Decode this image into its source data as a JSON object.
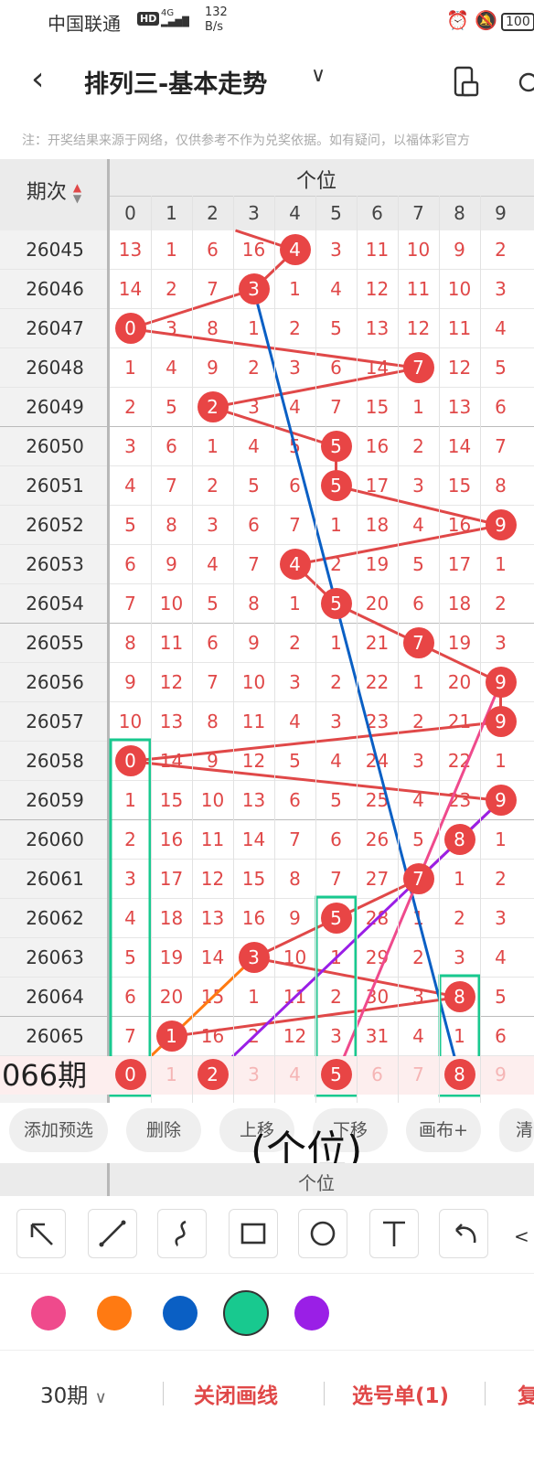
{
  "status_bar": {
    "carrier": "中国联通",
    "hd": "HD",
    "signal": "4G",
    "net_speed": "132",
    "net_unit": "B/s",
    "battery": "100"
  },
  "header": {
    "title": "排列三-基本走势"
  },
  "notice": "注：开奖结果来源于网络，仅供参考不作为兑奖依据。如有疑问，以福体彩官方",
  "table": {
    "period_header": "期次",
    "group_header": "个位",
    "digits": [
      "0",
      "1",
      "2",
      "3",
      "4",
      "5",
      "6",
      "7",
      "8",
      "9"
    ],
    "rows": [
      {
        "period": "26045",
        "cells": [
          "13",
          "1",
          "6",
          "16",
          "4",
          "3",
          "11",
          "10",
          "9",
          "2"
        ],
        "hit": 4
      },
      {
        "period": "26046",
        "cells": [
          "14",
          "2",
          "7",
          "3",
          "1",
          "4",
          "12",
          "11",
          "10",
          "3"
        ],
        "hit": 3
      },
      {
        "period": "26047",
        "cells": [
          "0",
          "3",
          "8",
          "1",
          "2",
          "5",
          "13",
          "12",
          "11",
          "4"
        ],
        "hit": 0
      },
      {
        "period": "26048",
        "cells": [
          "1",
          "4",
          "9",
          "2",
          "3",
          "6",
          "14",
          "7",
          "12",
          "5"
        ],
        "hit": 7
      },
      {
        "period": "26049",
        "cells": [
          "2",
          "5",
          "2",
          "3",
          "4",
          "7",
          "15",
          "1",
          "13",
          "6"
        ],
        "hit": 2
      },
      {
        "period": "26050",
        "cells": [
          "3",
          "6",
          "1",
          "4",
          "5",
          "5",
          "16",
          "2",
          "14",
          "7"
        ],
        "hit": 5
      },
      {
        "period": "26051",
        "cells": [
          "4",
          "7",
          "2",
          "5",
          "6",
          "5",
          "17",
          "3",
          "15",
          "8"
        ],
        "hit": 5
      },
      {
        "period": "26052",
        "cells": [
          "5",
          "8",
          "3",
          "6",
          "7",
          "1",
          "18",
          "4",
          "16",
          "9"
        ],
        "hit": 9
      },
      {
        "period": "26053",
        "cells": [
          "6",
          "9",
          "4",
          "7",
          "4",
          "2",
          "19",
          "5",
          "17",
          "1"
        ],
        "hit": 4
      },
      {
        "period": "26054",
        "cells": [
          "7",
          "10",
          "5",
          "8",
          "1",
          "5",
          "20",
          "6",
          "18",
          "2"
        ],
        "hit": 5
      },
      {
        "period": "26055",
        "cells": [
          "8",
          "11",
          "6",
          "9",
          "2",
          "1",
          "21",
          "7",
          "19",
          "3"
        ],
        "hit": 7
      },
      {
        "period": "26056",
        "cells": [
          "9",
          "12",
          "7",
          "10",
          "3",
          "2",
          "22",
          "1",
          "20",
          "9"
        ],
        "hit": 9
      },
      {
        "period": "26057",
        "cells": [
          "10",
          "13",
          "8",
          "11",
          "4",
          "3",
          "23",
          "2",
          "21",
          "9"
        ],
        "hit": 9
      },
      {
        "period": "26058",
        "cells": [
          "0",
          "14",
          "9",
          "12",
          "5",
          "4",
          "24",
          "3",
          "22",
          "1"
        ],
        "hit": 0
      },
      {
        "period": "26059",
        "cells": [
          "1",
          "15",
          "10",
          "13",
          "6",
          "5",
          "25",
          "4",
          "23",
          "9"
        ],
        "hit": 9
      },
      {
        "period": "26060",
        "cells": [
          "2",
          "16",
          "11",
          "14",
          "7",
          "6",
          "26",
          "5",
          "8",
          "1"
        ],
        "hit": 8
      },
      {
        "period": "26061",
        "cells": [
          "3",
          "17",
          "12",
          "15",
          "8",
          "7",
          "27",
          "7",
          "1",
          "2"
        ],
        "hit": 7
      },
      {
        "period": "26062",
        "cells": [
          "4",
          "18",
          "13",
          "16",
          "9",
          "5",
          "28",
          "1",
          "2",
          "3"
        ],
        "hit": 5
      },
      {
        "period": "26063",
        "cells": [
          "5",
          "19",
          "14",
          "3",
          "10",
          "1",
          "29",
          "2",
          "3",
          "4"
        ],
        "hit": 3
      },
      {
        "period": "26064",
        "cells": [
          "6",
          "20",
          "15",
          "1",
          "11",
          "2",
          "30",
          "3",
          "8",
          "5"
        ],
        "hit": 8
      },
      {
        "period": "26065",
        "cells": [
          "7",
          "1",
          "16",
          "2",
          "12",
          "3",
          "31",
          "4",
          "1",
          "6"
        ],
        "hit": 1
      }
    ],
    "preview": {
      "period": "066期",
      "cells": [
        "0",
        "1",
        "2",
        "3",
        "4",
        "5",
        "6",
        "7",
        "8",
        "9"
      ],
      "selected": [
        0,
        2,
        5,
        8
      ]
    }
  },
  "buttons": [
    "添加预选",
    "删除",
    "上移",
    "下移",
    "画布+",
    "清"
  ],
  "overlay_text": "(个位)",
  "footer_group_header": "个位",
  "tools": [
    "arrow-tool",
    "line-tool",
    "curve-tool",
    "rect-tool",
    "circle-tool",
    "text-tool",
    "undo-tool"
  ],
  "colors": [
    "#ef4a8c",
    "#ff7a12",
    "#0a5fc4",
    "#18c98f",
    "#9a1fe6"
  ],
  "bottom": {
    "periods": "30期",
    "close_draw": "关闭画线",
    "picklist": "选号单(1)",
    "more": "复"
  }
}
